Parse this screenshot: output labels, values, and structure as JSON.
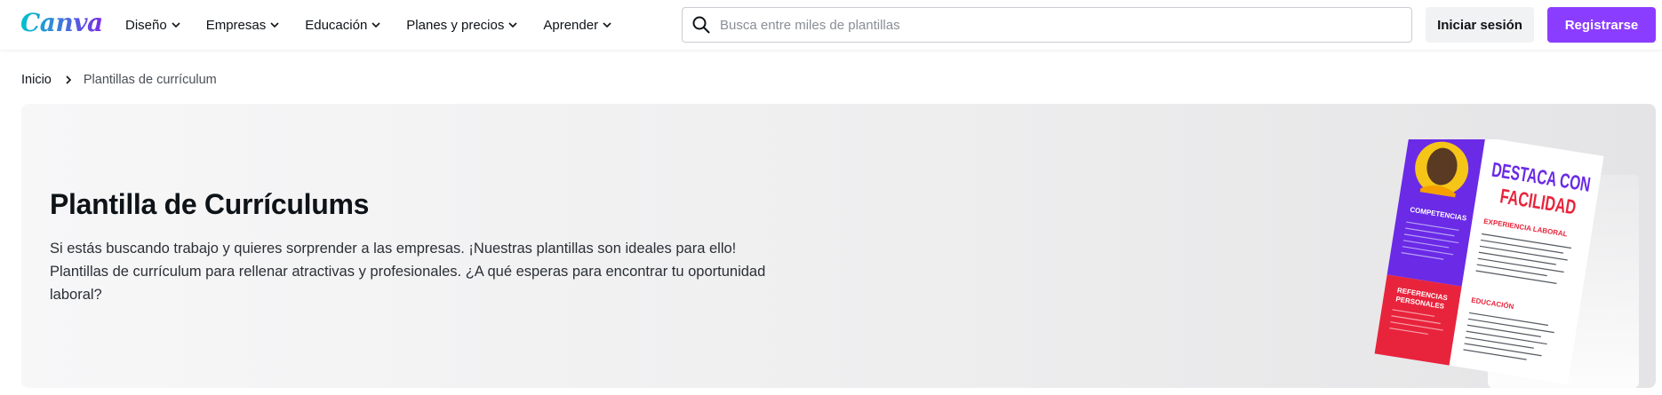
{
  "header": {
    "logo": "Canva",
    "nav": [
      {
        "label": "Diseño"
      },
      {
        "label": "Empresas"
      },
      {
        "label": "Educación"
      },
      {
        "label": "Planes y precios"
      },
      {
        "label": "Aprender"
      }
    ],
    "search_placeholder": "Busca entre miles de plantillas",
    "login_label": "Iniciar sesión",
    "register_label": "Registrarse"
  },
  "breadcrumb": {
    "home": "Inicio",
    "current": "Plantillas de currículum"
  },
  "hero": {
    "title": "Plantilla de Currículums",
    "description": "Si estás buscando trabajo y quieres sorprender a las empresas. ¡Nuestras plantillas son ideales para ello! Plantillas de currículum para rellenar atractivas y profesionales. ¿A qué esperas para encontrar tu oportunidad laboral?"
  },
  "resume": {
    "headline_1": "DESTACA CON",
    "headline_2": "FACILIDAD",
    "competencias": "COMPETENCIAS",
    "referencias_1": "REFERENCIAS",
    "referencias_2": "PERSONALES",
    "experiencia": "EXPERIENCIA LABORAL",
    "educacion": "EDUCACIÓN"
  },
  "colors": {
    "brand_purple": "#8b3dff",
    "resume_purple": "#6a2ae6",
    "resume_red": "#e8243c"
  }
}
